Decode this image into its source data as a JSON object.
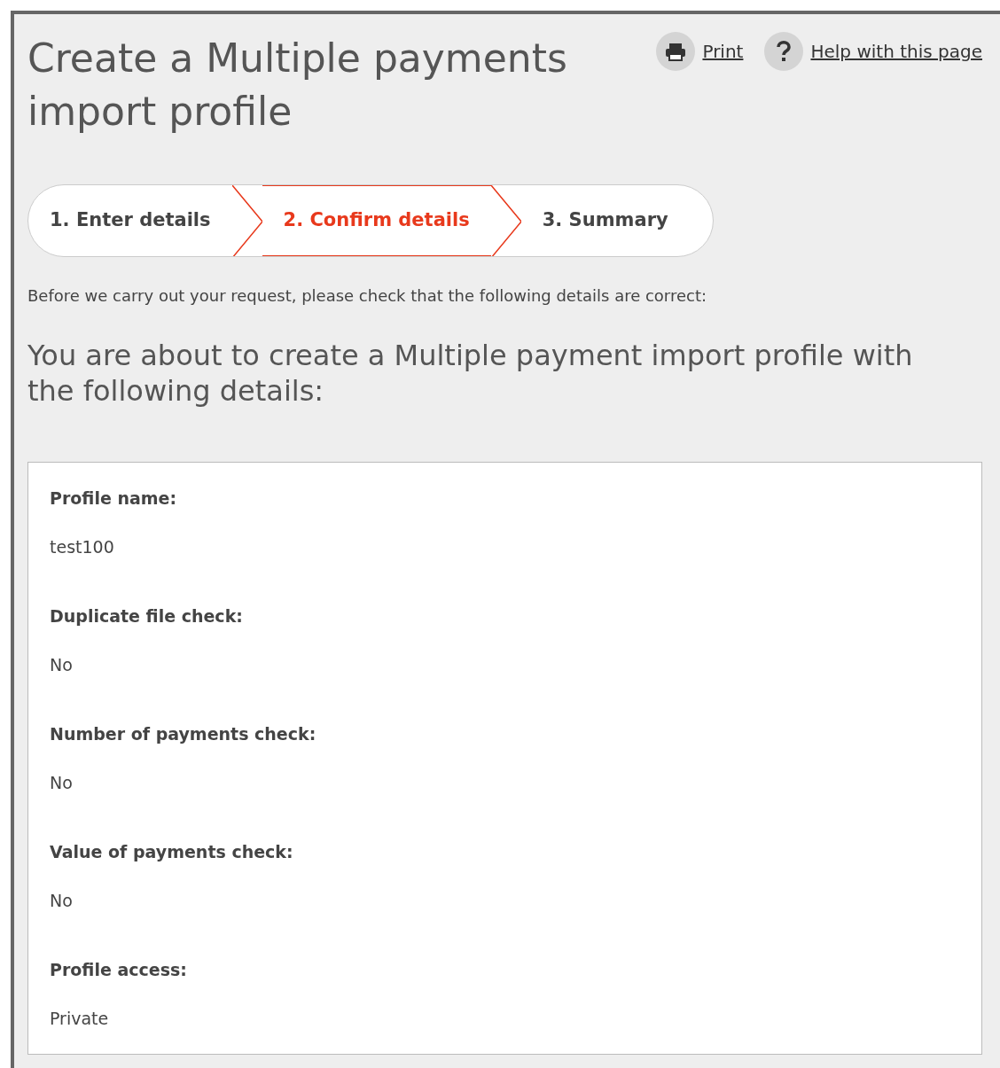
{
  "title": "Create a Multiple payments import profile",
  "links": [
    {
      "label": "Print",
      "kind": "print"
    },
    {
      "label": "Help with this page",
      "kind": "help"
    }
  ],
  "steps": [
    {
      "label": "1. Enter details",
      "selected": false
    },
    {
      "label": "2. Confirm details",
      "selected": true
    },
    {
      "label": "3. Summary",
      "selected": false
    }
  ],
  "intro": "Before we carry out your request, please check that the following details are correct:",
  "heading": "You are about to create a Multiple payment import profile with the following details:",
  "details": [
    {
      "label": "Profile name:",
      "value": "test100"
    },
    {
      "label": "Duplicate file check:",
      "value": "No"
    },
    {
      "label": "Number of payments check:",
      "value": "No"
    },
    {
      "label": "Value of payments check:",
      "value": "No"
    },
    {
      "label": "Profile access:",
      "value": "Private"
    }
  ]
}
